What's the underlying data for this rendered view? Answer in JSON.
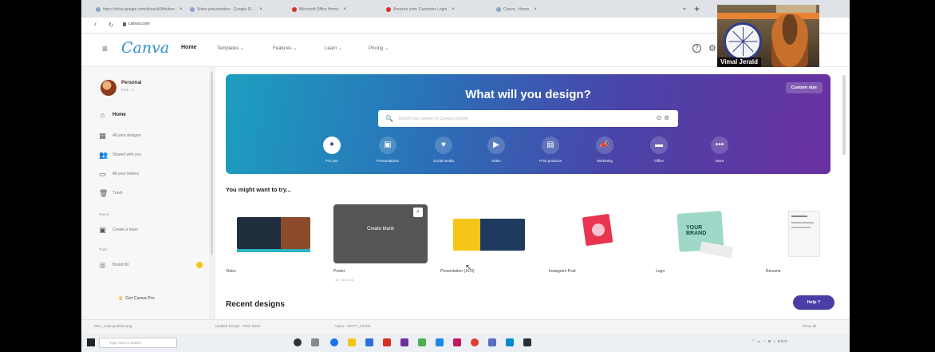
{
  "browser": {
    "tabs": [
      {
        "label": "https://drive.google.com/drive/u/0/folders"
      },
      {
        "label": "Video presentation - Google Sl..."
      },
      {
        "label": "Microsoft Office Home"
      },
      {
        "label": "Amazon.com: Customer Login"
      },
      {
        "label": "Canva - Home"
      }
    ],
    "url": "canva.com"
  },
  "canva": {
    "logo": "Canva",
    "menu": [
      "Home",
      "Templates",
      "Features",
      "Learn",
      "Pricing"
    ],
    "account": {
      "name": "Personal",
      "sub": "Free · 1"
    },
    "sidebar": {
      "items": [
        "Home",
        "All your designs",
        "Shared with you",
        "All your folders",
        "Trash"
      ],
      "team_label": "Teams",
      "team_item": "Create a team",
      "tools_label": "Tools",
      "tools_item": "Brand Kit",
      "get_pro": "Get Canva Pro"
    },
    "hero": {
      "title": "What will you design?",
      "custom_size": "Custom size",
      "search_placeholder": "Search your content or Canva's content",
      "categories": [
        "For you",
        "Presentations",
        "Social media",
        "Video",
        "Print products",
        "Marketing",
        "Office",
        "More"
      ]
    },
    "suggestions": {
      "title": "You might want to try...",
      "create_blank": "Create blank",
      "cards": [
        "Video",
        "Poster",
        "Presentation (16:9)",
        "Instagram Post",
        "Logo",
        "Resume"
      ],
      "poster_sub": "42 × 59.4 cm"
    },
    "recent_title": "Recent designs",
    "help_button": "Help ?"
  },
  "video_overlay": {
    "name": "Vimal Jerald"
  },
  "downloads": [
    "REC_cosmopolitan.png",
    "Untitled Design - Pitch Deck",
    "Video - MOTT_Cricket"
  ],
  "downloads_show_all": "Show all",
  "taskbar": {
    "search_placeholder": "Type here to search"
  }
}
